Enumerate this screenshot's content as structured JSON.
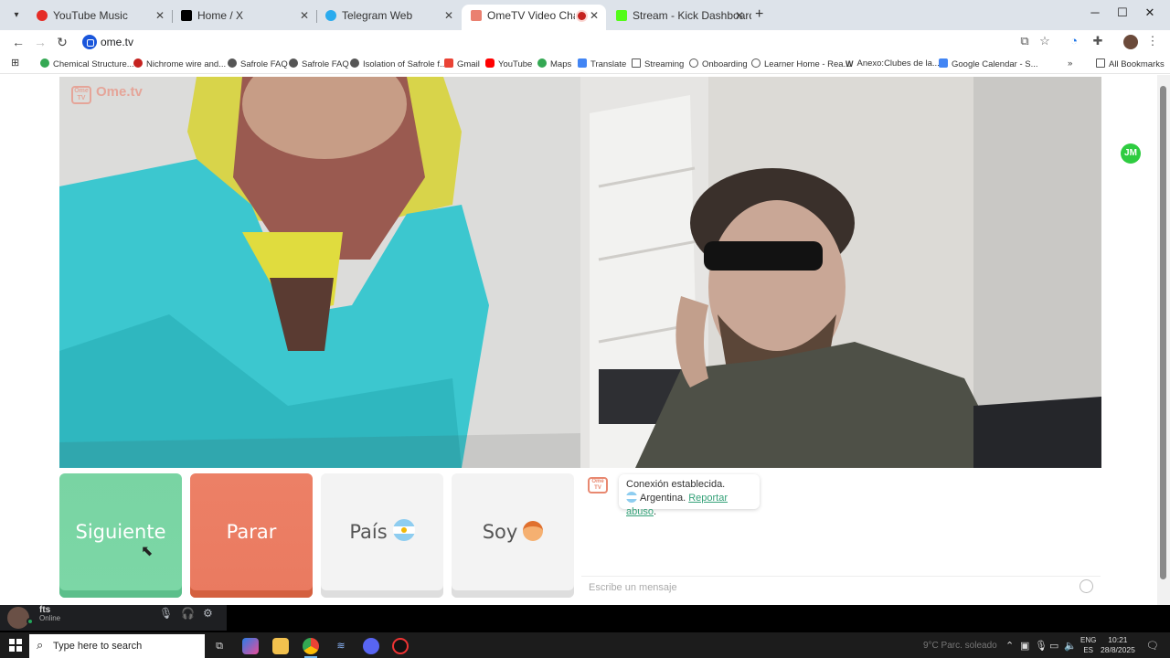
{
  "browser": {
    "tabs": [
      {
        "title": "YouTube Music",
        "color": "#e52d27"
      },
      {
        "title": "Home / X",
        "color": "#000000"
      },
      {
        "title": "Telegram Web",
        "color": "#2aabee"
      },
      {
        "title": "OmeTV Video Chat — Ome",
        "color": "#ea8070",
        "active": true
      },
      {
        "title": "Stream - Kick Dashboard",
        "color": "#53fc18"
      }
    ],
    "url": "ome.tv",
    "bookmarks": [
      {
        "label": "Chemical Structure...",
        "color": "#34a853"
      },
      {
        "label": "Nichrome wire and...",
        "color": "#c5221f"
      },
      {
        "label": "Safrole FAQ",
        "color": "#555555"
      },
      {
        "label": "Safrole FAQ",
        "color": "#555555"
      },
      {
        "label": "Isolation of Safrole f...",
        "color": "#555555"
      },
      {
        "label": "Gmail",
        "color": "#ea4335"
      },
      {
        "label": "YouTube",
        "color": "#ff0000"
      },
      {
        "label": "Maps",
        "color": "#34a853"
      },
      {
        "label": "Translate",
        "color": "#4285f4"
      },
      {
        "label": "Streaming",
        "color": "#555555"
      },
      {
        "label": "Onboarding",
        "color": "#555555"
      },
      {
        "label": "Learner Home - Rea...",
        "color": "#555555"
      },
      {
        "label": "Anexo:Clubes de la...",
        "color": "#333333"
      },
      {
        "label": "Google Calendar - S...",
        "color": "#4285f4"
      }
    ],
    "all_bookmarks": "All Bookmarks"
  },
  "page": {
    "logo_text": "Ome.tv",
    "logo_badge": "Ome TV",
    "side_extension": "JM",
    "buttons": {
      "next": "Siguiente",
      "stop": "Parar",
      "country": "País",
      "gender": "Soy"
    },
    "chat": {
      "status_line": "Conexión establecida.",
      "country": "Argentina.",
      "report_link": "Reportar abuso",
      "report_suffix": ".",
      "input_placeholder": "Escribe un mensaje"
    }
  },
  "discord": {
    "username": "fts",
    "status": "Online"
  },
  "taskbar": {
    "search_placeholder": "Type here to search",
    "weather": "9°C  Parc. soleado",
    "lang_top": "ENG",
    "lang_bottom": "ES",
    "time": "10:21",
    "date": "28/8/2025"
  }
}
